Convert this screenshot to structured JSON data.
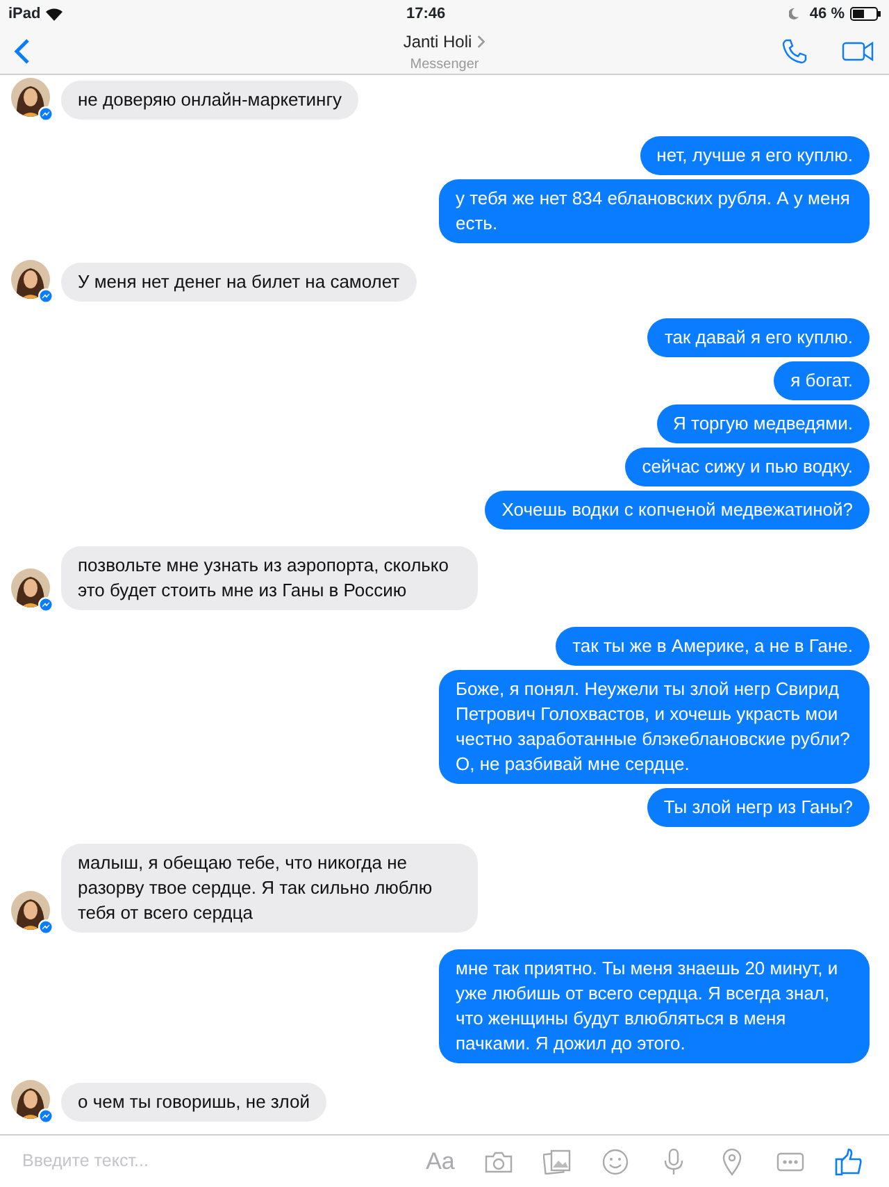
{
  "status_bar": {
    "device": "iPad",
    "time": "17:46",
    "battery": "46 %"
  },
  "header": {
    "title": "Janti Holi",
    "subtitle": "Messenger"
  },
  "messages": [
    {
      "kind": "in",
      "text": "не доверяю онлайн-маркетингу"
    },
    {
      "kind": "out",
      "text": "нет, лучше я его куплю."
    },
    {
      "kind": "out",
      "text": "у тебя же нет 834 еблановских рубля. А у меня есть."
    },
    {
      "kind": "in",
      "text": "У меня нет денег на билет на самолет"
    },
    {
      "kind": "out",
      "text": "так давай я его куплю."
    },
    {
      "kind": "out",
      "text": "я богат."
    },
    {
      "kind": "out",
      "text": "Я торгую медведями."
    },
    {
      "kind": "out",
      "text": "сейчас сижу и пью водку."
    },
    {
      "kind": "out",
      "text": "Хочешь водки с копченой медвежатиной?"
    },
    {
      "kind": "in",
      "text": "позвольте мне узнать из аэропорта, сколько это будет стоить мне из Ганы в Россию"
    },
    {
      "kind": "out",
      "text": "так ты же в Америке, а не в Гане."
    },
    {
      "kind": "out",
      "text": "Боже, я понял. Неужели ты злой негр Свирид Петрович Голохвастов, и хочешь украсть мои честно заработанные блэкеблановские рубли? О, не разбивай мне сердце."
    },
    {
      "kind": "out",
      "text": "Ты злой негр из Ганы?"
    },
    {
      "kind": "in",
      "text": "малыш, я обещаю тебе, что никогда не разорву твое сердце. Я так сильно люблю тебя от всего сердца"
    },
    {
      "kind": "out",
      "text": "мне так приятно. Ты меня знаешь 20 минут, и уже любишь от всего сердца. Я всегда знал, что женщины будут влюбляться в меня пачками. Я дожил до этого."
    },
    {
      "kind": "in",
      "text": "о чем ты говоришь, не злой"
    }
  ],
  "composer": {
    "placeholder": "Введите текст...",
    "font_button": "Aa"
  }
}
